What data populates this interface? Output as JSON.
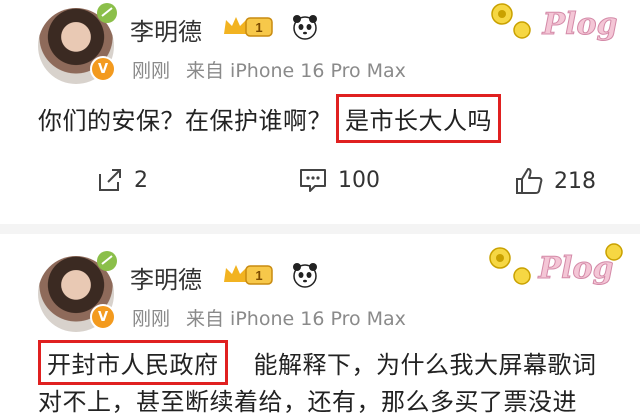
{
  "post1": {
    "username": "李明德",
    "vip_level": "1",
    "time": "刚刚",
    "source": "来自 iPhone 16 Pro Max",
    "content_main": "你们的安保？在保护谁啊？",
    "content_highlight": "是市长大人吗",
    "share_count": "2",
    "comment_count": "100",
    "like_count": "218",
    "deco_text": "Plog",
    "highlight_color": "#e02020"
  },
  "post2": {
    "username": "李明德",
    "vip_level": "1",
    "time": "刚刚",
    "source": "来自 iPhone 16 Pro Max",
    "deco_text": "Plog",
    "content_highlight": "开封市人民政府",
    "content_rest_line1": "能解释下，为什么我大屏幕歌词",
    "content_line2": "对不上，甚至断续着给，还有，那么多买了票没进"
  }
}
